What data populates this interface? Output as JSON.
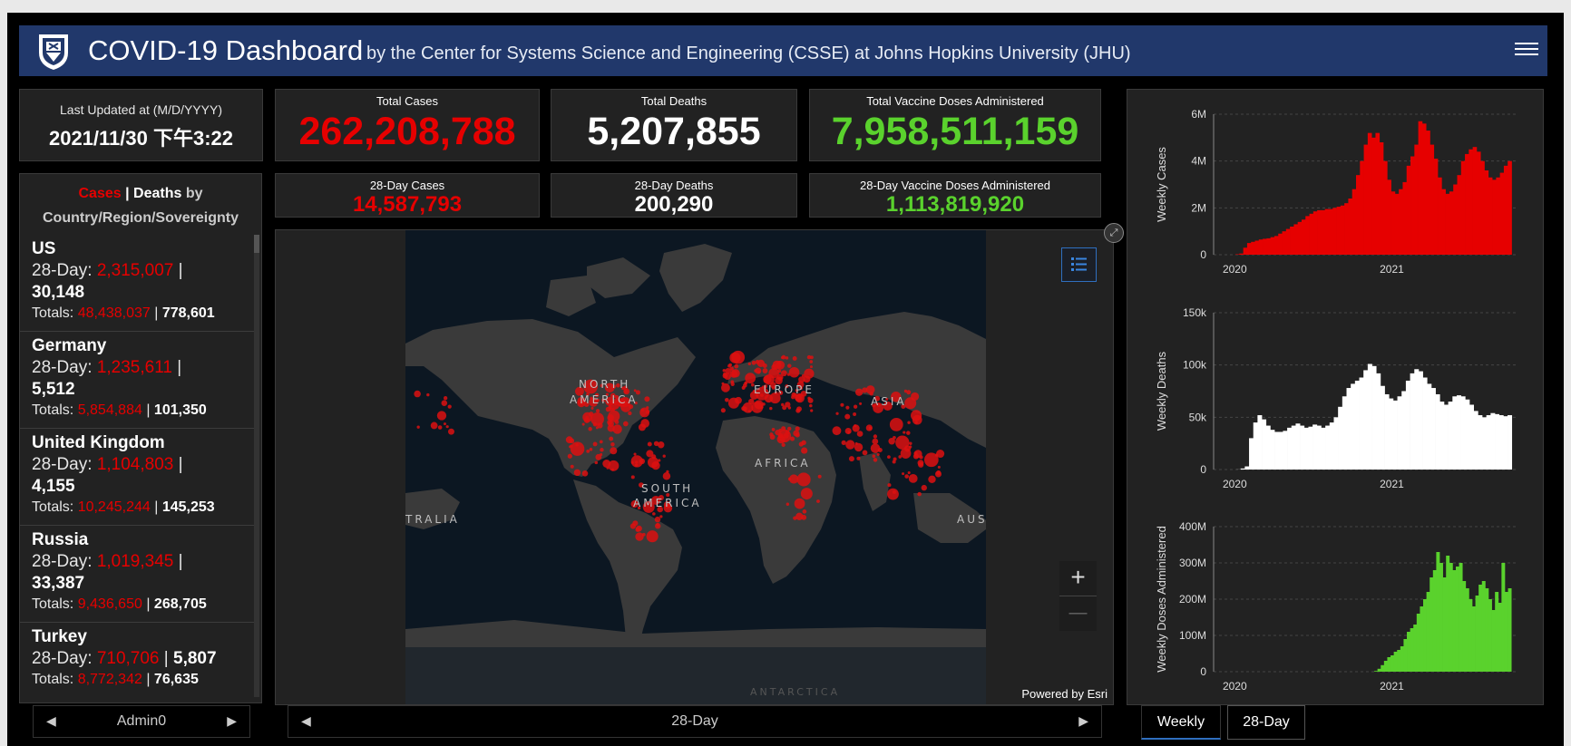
{
  "header": {
    "title": "COVID-19 Dashboard",
    "subtitle": "by the Center for Systems Science and Engineering (CSSE) at Johns Hopkins University (JHU)"
  },
  "last_updated": {
    "label": "Last Updated at (M/D/YYYY)",
    "value": "2021/11/30 下午3:22"
  },
  "totals": {
    "cases": {
      "label": "Total Cases",
      "value": "262,208,788"
    },
    "deaths": {
      "label": "Total Deaths",
      "value": "5,207,855"
    },
    "vaccine": {
      "label": "Total Vaccine Doses Administered",
      "value": "7,958,511,159"
    },
    "cases28": {
      "label": "28-Day Cases",
      "value": "14,587,793"
    },
    "deaths28": {
      "label": "28-Day Deaths",
      "value": "200,290"
    },
    "vaccine28": {
      "label": "28-Day Vaccine Doses Administered",
      "value": "1,113,819,920"
    }
  },
  "list": {
    "cases_label": "Cases",
    "sep": " | ",
    "deaths_label": "Deaths",
    "by": " by",
    "scope": "Country/Region/Sovereignty",
    "items": [
      {
        "name": "US",
        "d28_label": "28-Day: ",
        "cases28": "2,315,007",
        "deaths28": "30,148",
        "tot_label": "Totals: ",
        "cases": "48,438,037",
        "deaths": "778,601"
      },
      {
        "name": "Germany",
        "d28_label": "28-Day: ",
        "cases28": "1,235,611",
        "deaths28": "5,512",
        "tot_label": "Totals: ",
        "cases": "5,854,884",
        "deaths": "101,350"
      },
      {
        "name": "United Kingdom",
        "d28_label": "28-Day: ",
        "cases28": "1,104,803",
        "deaths28": "4,155",
        "tot_label": "Totals: ",
        "cases": "10,245,244",
        "deaths": "145,253"
      },
      {
        "name": "Russia",
        "d28_label": "28-Day: ",
        "cases28": "1,019,345",
        "deaths28": "33,387",
        "tot_label": "Totals: ",
        "cases": "9,436,650",
        "deaths": "268,705"
      },
      {
        "name": "Turkey",
        "d28_label": "28-Day: ",
        "cases28": "710,706",
        "deaths28": "5,807",
        "tot_label": "Totals: ",
        "cases": "8,772,342",
        "deaths": "76,635"
      }
    ]
  },
  "list_pager": {
    "label": "Admin0"
  },
  "map_pager": {
    "label": "28-Day"
  },
  "map": {
    "labels": [
      "NORTH",
      "AMERICA",
      "EUROPE",
      "ASIA",
      "AFRICA",
      "SOUTH",
      "AMERICA",
      "TRALIA",
      "AUS",
      "ANTARCTICA"
    ],
    "zoom_in": "+",
    "zoom_out": "—",
    "attribution": "Powered by Esri"
  },
  "tabs": {
    "weekly": "Weekly",
    "day28": "28-Day"
  },
  "colors": {
    "cases": "#e60000",
    "deaths": "#ffffff",
    "vaccine": "#5ad22d",
    "header": "#21386b"
  },
  "chart_data": [
    {
      "type": "area",
      "ylabel": "Weekly Cases",
      "ylim": [
        0,
        6000000
      ],
      "yticks": [
        "0",
        "2M",
        "4M",
        "6M"
      ],
      "xticks": [
        "2020",
        "2021"
      ],
      "x_start": "2020-01-22",
      "x_step_days": 7,
      "values": [
        0,
        0,
        0,
        20000,
        50000,
        300000,
        500000,
        550000,
        600000,
        650000,
        680000,
        700000,
        750000,
        800000,
        900000,
        1000000,
        1100000,
        1200000,
        1300000,
        1400000,
        1500000,
        1650000,
        1750000,
        1850000,
        1900000,
        1900000,
        1950000,
        1950000,
        2000000,
        2050000,
        2100000,
        2200000,
        2400000,
        2800000,
        3400000,
        4000000,
        4700000,
        5200000,
        5000000,
        5200000,
        4800000,
        4000000,
        3200000,
        2700000,
        2600000,
        2800000,
        3100000,
        3800000,
        4200000,
        4700000,
        5700000,
        5600000,
        5300000,
        4700000,
        4100000,
        3300000,
        2800000,
        2600000,
        2700000,
        3000000,
        3400000,
        4000000,
        4300000,
        4500000,
        4600000,
        4400000,
        4000000,
        3600000,
        3300000,
        3200000,
        3300000,
        3500000,
        3800000,
        4000000
      ]
    },
    {
      "type": "area",
      "ylabel": "Weekly Deaths",
      "ylim": [
        0,
        150000
      ],
      "yticks": [
        "0",
        "50k",
        "100k",
        "150k"
      ],
      "xticks": [
        "2020",
        "2021"
      ],
      "x_start": "2020-01-22",
      "x_step_days": 7,
      "values": [
        0,
        0,
        0,
        100,
        1000,
        3000,
        30000,
        45000,
        52000,
        48000,
        42000,
        38000,
        36000,
        36000,
        37000,
        40000,
        42000,
        44000,
        42000,
        40000,
        41000,
        43000,
        42000,
        40000,
        42000,
        45000,
        50000,
        60000,
        70000,
        78000,
        82000,
        85000,
        88000,
        95000,
        101000,
        99000,
        92000,
        80000,
        72000,
        68000,
        66000,
        70000,
        75000,
        85000,
        92000,
        96000,
        94000,
        88000,
        82000,
        78000,
        72000,
        65000,
        62000,
        65000,
        70000,
        71000,
        70000,
        67000,
        62000,
        56000,
        52000,
        50000,
        52000,
        54000,
        53000,
        52000,
        51000,
        52000
      ]
    },
    {
      "type": "bar",
      "ylabel": "Weekly Doses Administered",
      "ylim": [
        0,
        400000000
      ],
      "yticks": [
        "0",
        "100M",
        "200M",
        "300M",
        "400M"
      ],
      "xticks": [
        "2020",
        "2021"
      ],
      "x_start": "2020-01-22",
      "x_step_days": 7,
      "values": [
        0,
        0,
        0,
        0,
        0,
        0,
        0,
        0,
        0,
        0,
        0,
        0,
        0,
        0,
        0,
        0,
        0,
        0,
        0,
        0,
        0,
        0,
        0,
        0,
        0,
        0,
        0,
        0,
        0,
        0,
        0,
        0,
        0,
        0,
        0,
        0,
        0,
        0,
        0,
        0,
        0,
        0,
        0,
        0,
        0,
        0,
        2000000,
        8000000,
        18000000,
        30000000,
        40000000,
        45000000,
        55000000,
        60000000,
        70000000,
        90000000,
        110000000,
        120000000,
        130000000,
        160000000,
        180000000,
        200000000,
        220000000,
        260000000,
        280000000,
        330000000,
        300000000,
        260000000,
        320000000,
        300000000,
        280000000,
        290000000,
        300000000,
        250000000,
        230000000,
        200000000,
        180000000,
        210000000,
        240000000,
        250000000,
        230000000,
        200000000,
        170000000,
        220000000,
        190000000,
        300000000,
        220000000,
        230000000
      ]
    }
  ]
}
